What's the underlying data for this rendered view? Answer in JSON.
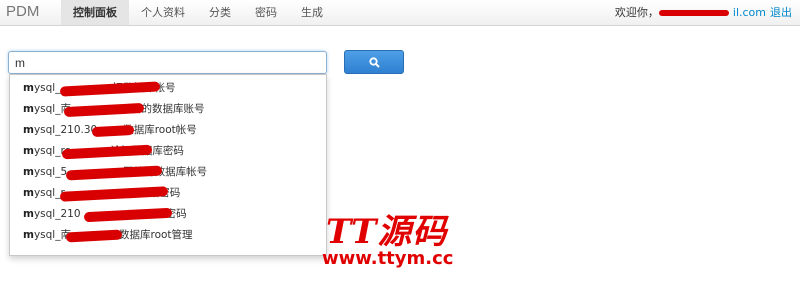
{
  "navbar": {
    "brand": "PDM",
    "items": [
      {
        "label": "控制面板",
        "active": true
      },
      {
        "label": "个人资料",
        "active": false
      },
      {
        "label": "分类",
        "active": false
      },
      {
        "label": "密码",
        "active": false
      },
      {
        "label": "生成",
        "active": false
      }
    ],
    "greeting": "欢迎你，",
    "email_tail": "il.com",
    "logout": "退出"
  },
  "search": {
    "value": "m",
    "icon": "search-icon"
  },
  "suggestions": [
    {
      "prefix": "m",
      "text": "ysql_",
      "after": "坛数据库帐号"
    },
    {
      "prefix": "m",
      "text": "ysql_南",
      "after": "目的数据库账号"
    },
    {
      "prefix": "m",
      "text": "ysql_210.30",
      "after": "数据库root帐号"
    },
    {
      "prefix": "m",
      "text": "ysql_rc",
      "after": "论坛数据库密码"
    },
    {
      "prefix": "m",
      "text": "ysql_5",
      "after": "网站的数据库帐号"
    },
    {
      "prefix": "m",
      "text": "ysql_r",
      "after": "站密码"
    },
    {
      "prefix": "m",
      "text": "ysql_210",
      "after": "root密码"
    },
    {
      "prefix": "m",
      "text": "ysql_南",
      "after": "数据库root管理"
    }
  ],
  "watermark": {
    "logo": "TT源码",
    "url": "www.ttym.cc"
  },
  "colors": {
    "accent": "#0088cc",
    "button": "#3a8ddb",
    "redaction": "#d80000",
    "watermark": "#e00000"
  }
}
